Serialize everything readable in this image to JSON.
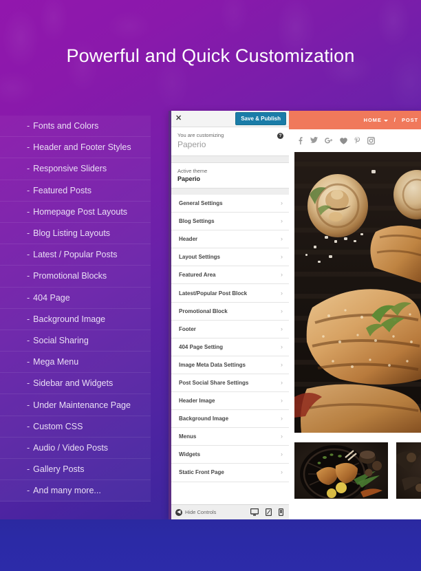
{
  "hero": {
    "title": "Powerful and Quick Customization"
  },
  "colors": {
    "bg_top_purple": "#9217ad",
    "bg_bottom_blue": "#2c2ba9",
    "publish_button": "#1a7ca8",
    "preview_nav": "#f0795b",
    "panel_accent": "#5b2d82"
  },
  "features": {
    "bullet": "-",
    "items": [
      {
        "label": "Fonts and Colors"
      },
      {
        "label": "Header and Footer Styles"
      },
      {
        "label": "Responsive Sliders"
      },
      {
        "label": "Featured Posts"
      },
      {
        "label": "Homepage Post Layouts"
      },
      {
        "label": "Blog Listing Layouts"
      },
      {
        "label": "Latest / Popular Posts"
      },
      {
        "label": "Promotional Blocks"
      },
      {
        "label": "404 Page"
      },
      {
        "label": "Background Image"
      },
      {
        "label": "Social Sharing"
      },
      {
        "label": "Mega Menu"
      },
      {
        "label": "Sidebar and Widgets"
      },
      {
        "label": "Under Maintenance Page"
      },
      {
        "label": "Custom CSS"
      },
      {
        "label": "Audio / Video Posts"
      },
      {
        "label": "Gallery Posts"
      },
      {
        "label": "And many more..."
      }
    ]
  },
  "customizer": {
    "close_label": "✕",
    "publish_label": "Save & Publish",
    "help_label": "?",
    "customizing_label": "You are customizing",
    "customizing_theme": "Paperio",
    "active_theme_label": "Active theme",
    "active_theme_name": "Paperio",
    "chevron": "›",
    "menu_items": [
      {
        "label": "General Settings"
      },
      {
        "label": "Blog Settings"
      },
      {
        "label": "Header"
      },
      {
        "label": "Layout Settings"
      },
      {
        "label": "Featured Area"
      },
      {
        "label": "Latest/Popular Post Block"
      },
      {
        "label": "Promotional Block"
      },
      {
        "label": "Footer"
      },
      {
        "label": "404 Page Setting"
      },
      {
        "label": "Image Meta Data Settings"
      },
      {
        "label": "Post Social Share Settings"
      },
      {
        "label": "Header Image"
      },
      {
        "label": "Background Image"
      },
      {
        "label": "Menus"
      },
      {
        "label": "Widgets"
      },
      {
        "label": "Static Front Page"
      }
    ],
    "footer": {
      "hide_controls_label": "Hide Controls",
      "hide_icon": "◀",
      "devices": [
        {
          "name": "desktop-view-icon"
        },
        {
          "name": "tablet-view-icon"
        },
        {
          "name": "mobile-view-icon"
        }
      ]
    }
  },
  "preview": {
    "nav": {
      "home_label": "HOME",
      "separator": "/",
      "post_label": "POST"
    },
    "social_icons": [
      {
        "name": "facebook-icon",
        "glyph": "f"
      },
      {
        "name": "twitter-icon",
        "glyph": "t"
      },
      {
        "name": "google-plus-icon",
        "glyph": "g+"
      },
      {
        "name": "bloglovin-heart-icon",
        "glyph": "♥"
      },
      {
        "name": "pinterest-icon",
        "glyph": "P"
      },
      {
        "name": "instagram-icon",
        "glyph": "ig"
      }
    ]
  }
}
